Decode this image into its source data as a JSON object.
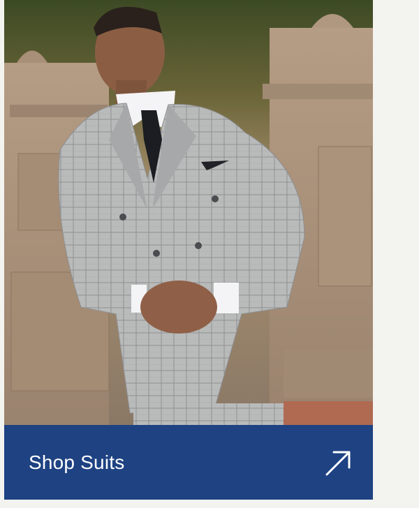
{
  "hero": {
    "icon": "product-photo",
    "colors": {
      "suit": "#b7b8b8",
      "background": "#a88c6a"
    }
  },
  "cta": {
    "label": "Shop Suits",
    "icon": "arrow-up-right-icon",
    "colors": {
      "background": "#1e4282",
      "text": "#ffffff"
    }
  }
}
